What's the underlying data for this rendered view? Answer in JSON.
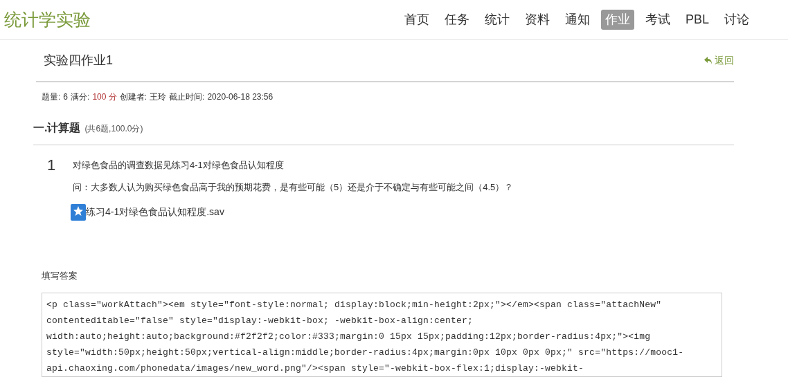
{
  "header": {
    "logo": "统计学实验",
    "nav": [
      {
        "label": "首页",
        "selected": false
      },
      {
        "label": "任务",
        "selected": false
      },
      {
        "label": "统计",
        "selected": false
      },
      {
        "label": "资料",
        "selected": false
      },
      {
        "label": "通知",
        "selected": false
      },
      {
        "label": "作业",
        "selected": true
      },
      {
        "label": "考试",
        "selected": false
      },
      {
        "label": "PBL",
        "selected": false
      },
      {
        "label": "讨论",
        "selected": false
      }
    ]
  },
  "assignment": {
    "title": "实验四作业1",
    "back": "返回",
    "meta": {
      "count_label": "题量:",
      "count": "6",
      "score_label": "满分:",
      "score": "100 分",
      "creator_label": "创建者:",
      "creator": "王玲",
      "deadline_label": "截止时间:",
      "deadline": "2020-06-18 23:56"
    }
  },
  "section": {
    "title": "一.计算题",
    "summary": "(共6题,100.0分)"
  },
  "question": {
    "number": "1",
    "text": "对绿色食品的调查数据见练习4-1对绿色食品认知程度",
    "prompt": "问：大多数人认为购买绿色食品高于我的预期花费，是有些可能（5）还是介于不确定与有些可能之间（4.5）？",
    "attachment": "练习4-1对绿色食品认知程度.sav"
  },
  "answer": {
    "label": "填写答案",
    "lines": [
      "<p class=\"workAttach\"><em style=\"font-style:normal; display:block;min-height:2px;\"></em><span class=\"attachNew\"",
      "contenteditable=\"false\" style=\"display:-webkit-box; -webkit-box-align:center;",
      "width:auto;height:auto;background:#f2f2f2;color:#333;margin:0 15px 15px;padding:12px;border-radius:4px;\"><img",
      "style=\"width:50px;height:50px;vertical-align:middle;border-radius:4px;margin:0px 10px 0px 0px;\" src=\"https://mooc1-",
      "api.chaoxing.com/phonedata/images/new_word.png\"/><span style=\"-webkit-box-flex:1;display:-webkit-"
    ]
  }
}
